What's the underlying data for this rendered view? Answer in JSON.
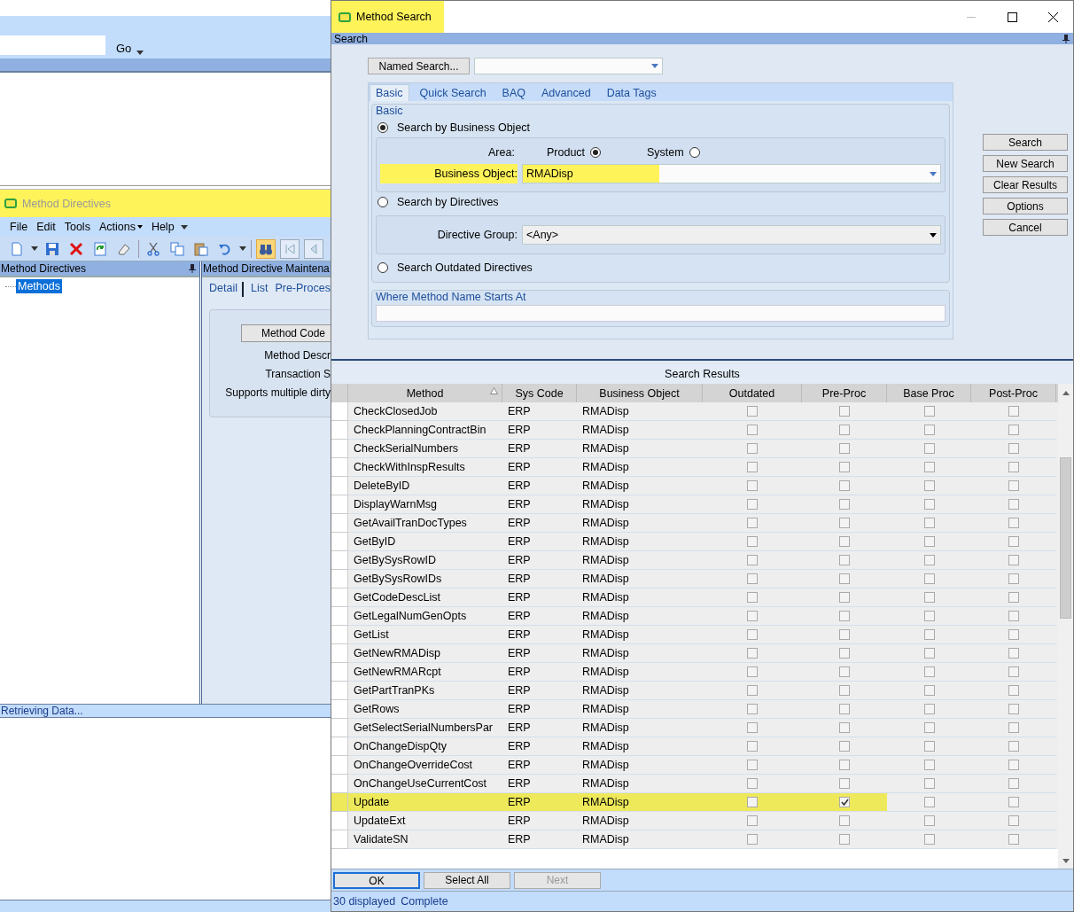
{
  "background_window": {
    "go_button": "Go"
  },
  "directives_window": {
    "title": "Method Directives",
    "highlighted": true,
    "menu": [
      {
        "label": "File",
        "dropdown": false
      },
      {
        "label": "Edit",
        "dropdown": false
      },
      {
        "label": "Tools",
        "dropdown": false
      },
      {
        "label": "Actions",
        "dropdown": true
      },
      {
        "label": "Help",
        "dropdown": false
      }
    ],
    "tree_panel": {
      "header": "Method Directives",
      "items": [
        {
          "label": "Methods",
          "selected": true
        }
      ]
    },
    "detail_panel": {
      "header": "Method Directive Maintena",
      "tabs": [
        {
          "label": "Detail",
          "selected": true
        },
        {
          "label": "List",
          "selected": false
        },
        {
          "label": "Pre-Proces",
          "selected": false
        }
      ],
      "method_code_button": "Method Code",
      "fields": [
        "Method Descr",
        "Transaction S",
        "Supports multiple dirty"
      ]
    },
    "status_bar": "Retrieving Data..."
  },
  "search_dialog": {
    "title": "Method Search",
    "title_highlighted": true,
    "pane_header": "Search",
    "named_search_button": "Named Search...",
    "tabs": [
      {
        "label": "Basic",
        "selected": true
      },
      {
        "label": "Quick Search",
        "selected": false
      },
      {
        "label": "BAQ",
        "selected": false
      },
      {
        "label": "Advanced",
        "selected": false
      },
      {
        "label": "Data Tags",
        "selected": false
      }
    ],
    "group_label": "Basic",
    "search_modes": [
      {
        "label": "Search by Business Object",
        "selected": true
      },
      {
        "label": "Search by Directives",
        "selected": false
      },
      {
        "label": "Search Outdated Directives",
        "selected": false
      }
    ],
    "area_label": "Area:",
    "area_options": [
      {
        "label": "Product",
        "selected": true
      },
      {
        "label": "System",
        "selected": false
      }
    ],
    "business_object": {
      "label": "Business Object:",
      "value": "RMADisp",
      "highlighted": true
    },
    "directive_group": {
      "label": "Directive Group:",
      "value": "<Any>"
    },
    "where_label": "Where Method Name Starts At",
    "side_buttons": [
      "Search",
      "New Search",
      "Clear Results",
      "Options",
      "Cancel"
    ],
    "results": {
      "title": "Search Results",
      "columns": [
        {
          "label": "Method",
          "sorted": true
        },
        {
          "label": "Sys Code",
          "sorted": false
        },
        {
          "label": "Business Object",
          "sorted": false
        },
        {
          "label": "Outdated",
          "sorted": false
        },
        {
          "label": "Pre-Proc",
          "sorted": false
        },
        {
          "label": "Base Proc",
          "sorted": false
        },
        {
          "label": "Post-Proc",
          "sorted": false
        }
      ],
      "rows": [
        {
          "method": "CheckClosedJob",
          "sys_code": "ERP",
          "business_object": "RMADisp",
          "outdated": false,
          "pre_proc": false,
          "base_proc": false,
          "post_proc": false,
          "highlighted": false
        },
        {
          "method": "CheckPlanningContractBin",
          "sys_code": "ERP",
          "business_object": "RMADisp",
          "outdated": false,
          "pre_proc": false,
          "base_proc": false,
          "post_proc": false,
          "highlighted": false
        },
        {
          "method": "CheckSerialNumbers",
          "sys_code": "ERP",
          "business_object": "RMADisp",
          "outdated": false,
          "pre_proc": false,
          "base_proc": false,
          "post_proc": false,
          "highlighted": false
        },
        {
          "method": "CheckWithInspResults",
          "sys_code": "ERP",
          "business_object": "RMADisp",
          "outdated": false,
          "pre_proc": false,
          "base_proc": false,
          "post_proc": false,
          "highlighted": false
        },
        {
          "method": "DeleteByID",
          "sys_code": "ERP",
          "business_object": "RMADisp",
          "outdated": false,
          "pre_proc": false,
          "base_proc": false,
          "post_proc": false,
          "highlighted": false
        },
        {
          "method": "DisplayWarnMsg",
          "sys_code": "ERP",
          "business_object": "RMADisp",
          "outdated": false,
          "pre_proc": false,
          "base_proc": false,
          "post_proc": false,
          "highlighted": false
        },
        {
          "method": "GetAvailTranDocTypes",
          "sys_code": "ERP",
          "business_object": "RMADisp",
          "outdated": false,
          "pre_proc": false,
          "base_proc": false,
          "post_proc": false,
          "highlighted": false
        },
        {
          "method": "GetByID",
          "sys_code": "ERP",
          "business_object": "RMADisp",
          "outdated": false,
          "pre_proc": false,
          "base_proc": false,
          "post_proc": false,
          "highlighted": false
        },
        {
          "method": "GetBySysRowID",
          "sys_code": "ERP",
          "business_object": "RMADisp",
          "outdated": false,
          "pre_proc": false,
          "base_proc": false,
          "post_proc": false,
          "highlighted": false
        },
        {
          "method": "GetBySysRowIDs",
          "sys_code": "ERP",
          "business_object": "RMADisp",
          "outdated": false,
          "pre_proc": false,
          "base_proc": false,
          "post_proc": false,
          "highlighted": false
        },
        {
          "method": "GetCodeDescList",
          "sys_code": "ERP",
          "business_object": "RMADisp",
          "outdated": false,
          "pre_proc": false,
          "base_proc": false,
          "post_proc": false,
          "highlighted": false
        },
        {
          "method": "GetLegalNumGenOpts",
          "sys_code": "ERP",
          "business_object": "RMADisp",
          "outdated": false,
          "pre_proc": false,
          "base_proc": false,
          "post_proc": false,
          "highlighted": false
        },
        {
          "method": "GetList",
          "sys_code": "ERP",
          "business_object": "RMADisp",
          "outdated": false,
          "pre_proc": false,
          "base_proc": false,
          "post_proc": false,
          "highlighted": false
        },
        {
          "method": "GetNewRMADisp",
          "sys_code": "ERP",
          "business_object": "RMADisp",
          "outdated": false,
          "pre_proc": false,
          "base_proc": false,
          "post_proc": false,
          "highlighted": false
        },
        {
          "method": "GetNewRMARcpt",
          "sys_code": "ERP",
          "business_object": "RMADisp",
          "outdated": false,
          "pre_proc": false,
          "base_proc": false,
          "post_proc": false,
          "highlighted": false
        },
        {
          "method": "GetPartTranPKs",
          "sys_code": "ERP",
          "business_object": "RMADisp",
          "outdated": false,
          "pre_proc": false,
          "base_proc": false,
          "post_proc": false,
          "highlighted": false
        },
        {
          "method": "GetRows",
          "sys_code": "ERP",
          "business_object": "RMADisp",
          "outdated": false,
          "pre_proc": false,
          "base_proc": false,
          "post_proc": false,
          "highlighted": false
        },
        {
          "method": "GetSelectSerialNumbersPar",
          "sys_code": "ERP",
          "business_object": "RMADisp",
          "outdated": false,
          "pre_proc": false,
          "base_proc": false,
          "post_proc": false,
          "highlighted": false
        },
        {
          "method": "OnChangeDispQty",
          "sys_code": "ERP",
          "business_object": "RMADisp",
          "outdated": false,
          "pre_proc": false,
          "base_proc": false,
          "post_proc": false,
          "highlighted": false
        },
        {
          "method": "OnChangeOverrideCost",
          "sys_code": "ERP",
          "business_object": "RMADisp",
          "outdated": false,
          "pre_proc": false,
          "base_proc": false,
          "post_proc": false,
          "highlighted": false
        },
        {
          "method": "OnChangeUseCurrentCost",
          "sys_code": "ERP",
          "business_object": "RMADisp",
          "outdated": false,
          "pre_proc": false,
          "base_proc": false,
          "post_proc": false,
          "highlighted": false
        },
        {
          "method": "Update",
          "sys_code": "ERP",
          "business_object": "RMADisp",
          "outdated": false,
          "pre_proc": true,
          "base_proc": false,
          "post_proc": false,
          "highlighted": true
        },
        {
          "method": "UpdateExt",
          "sys_code": "ERP",
          "business_object": "RMADisp",
          "outdated": false,
          "pre_proc": false,
          "base_proc": false,
          "post_proc": false,
          "highlighted": false
        },
        {
          "method": "ValidateSN",
          "sys_code": "ERP",
          "business_object": "RMADisp",
          "outdated": false,
          "pre_proc": false,
          "base_proc": false,
          "post_proc": false,
          "highlighted": false
        }
      ]
    },
    "bottom_buttons": [
      {
        "label": "OK",
        "disabled": false,
        "focused": true
      },
      {
        "label": "Select All",
        "disabled": false,
        "focused": false
      },
      {
        "label": "Next",
        "disabled": true,
        "focused": false
      }
    ],
    "status": {
      "count": "30 displayed",
      "state": "Complete"
    }
  }
}
